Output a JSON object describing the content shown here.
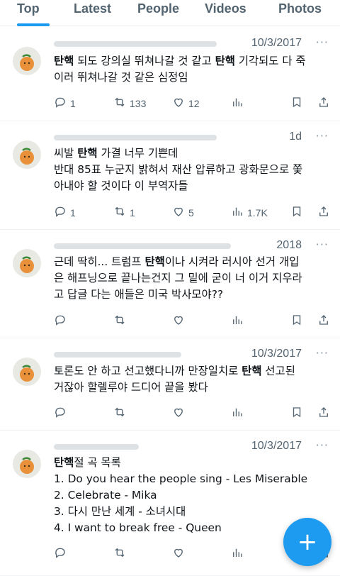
{
  "tabs": [
    {
      "label": "Top",
      "active": true
    },
    {
      "label": "Latest",
      "active": false
    },
    {
      "label": "People",
      "active": false
    },
    {
      "label": "Videos",
      "active": false
    },
    {
      "label": "Photos",
      "active": false
    }
  ],
  "tweets": [
    {
      "date": "10/3/2017",
      "lines": [
        [
          "탄핵",
          " 되도 강의실 뛰쳐나갈 것 같고 ",
          "탄핵",
          " 기각되도 다 죽"
        ],
        [
          "이러 뛰쳐나갈 것 같은 심정임"
        ]
      ],
      "replies": "1",
      "retweets": "133",
      "likes": "12",
      "views": ""
    },
    {
      "date": "1d",
      "lines": [
        [
          "씨발 ",
          "탄핵",
          " 가결 너무 기쁜데"
        ],
        [
          "반대 85표 누군지 밝혀서 재산 압류하고 광화문으로 쫓"
        ],
        [
          "아내야 할 것이다 이 부역자들"
        ]
      ],
      "replies": "1",
      "retweets": "1",
      "likes": "5",
      "views": "1.7K"
    },
    {
      "date": "2018",
      "lines": [
        [
          "근데 딱히... 트럼프 ",
          "탄핵",
          "이나 시켜라 러시아 선거 개입"
        ],
        [
          "은 해프닝으로 끝나는건지 그 밑에 굳이 너 이거 지우라"
        ],
        [
          "고 답글 다는 애들은 미국 박사모야??"
        ]
      ],
      "replies": "",
      "retweets": "",
      "likes": "",
      "views": ""
    },
    {
      "date": "10/3/2017",
      "lines": [
        [
          "토론도 안 하고 선고했다니까 만장일치로 ",
          "탄핵",
          " 선고된"
        ],
        [
          "거잖아 할렐루야 드디어 끝을 봤다"
        ]
      ],
      "replies": "",
      "retweets": "",
      "likes": "",
      "views": ""
    },
    {
      "date": "10/3/2017",
      "lines": [
        [
          "탄핵",
          "절 곡 목록"
        ],
        [
          "1. Do you hear the people sing - Les Miserable"
        ],
        [
          "2. Celebrate - Mika"
        ],
        [
          "3. 다시 만난 세계 - 소녀시대"
        ],
        [
          "4. I want to break free - Queen"
        ]
      ],
      "replies": "",
      "retweets": "",
      "likes": "",
      "views": ""
    }
  ],
  "fab": {
    "label": "+"
  },
  "colors": {
    "accent": "#1d9bf0",
    "text": "#0f1419",
    "muted": "#536471"
  }
}
